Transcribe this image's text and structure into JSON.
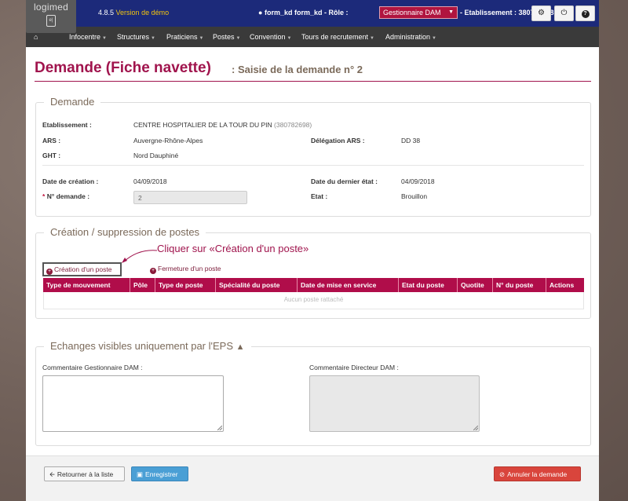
{
  "header": {
    "logo_text": "logimed",
    "logo_glyph": "e|",
    "version": "4.8.5",
    "version_tag": "Version de démo",
    "user": "form_kd form_kd - Rôle :",
    "role_value": "Gestionnaire DAM",
    "etablissement": "- Etablissement : 380782698",
    "icons": [
      "gear-icon",
      "power-icon",
      "help-icon"
    ]
  },
  "nav": {
    "home_icon": "home-icon",
    "items": [
      "Infocentre",
      "Structures",
      "Praticiens",
      "Postes",
      "Convention",
      "Tours de recrutement",
      "Administration"
    ]
  },
  "page": {
    "title": "Demande (Fiche navette)",
    "subtitle": ": Saisie de la demande n° 2"
  },
  "demande": {
    "legend": "Demande",
    "etab_label": "Etablissement :",
    "etab_value": "CENTRE HOSPITALIER DE LA TOUR DU PIN",
    "etab_code": "(380782698)",
    "ars_label": "ARS :",
    "ars_value": "Auvergne-Rhône-Alpes",
    "delegation_label": "Délégation ARS :",
    "delegation_value": "DD 38",
    "ght_label": "GHT :",
    "ght_value": "Nord Dauphiné",
    "creation_label": "Date de création :",
    "creation_value": "04/09/2018",
    "dernier_etat_label": "Date du dernier état :",
    "dernier_etat_value": "04/09/2018",
    "num_label": "N° demande :",
    "num_required": "*",
    "num_value": "2",
    "etat_label": "Etat :",
    "etat_value": "Brouillon"
  },
  "postes": {
    "legend": "Création / suppression de postes",
    "creation_btn": "Création d'un poste",
    "fermeture_btn": "Fermeture d'un poste",
    "annotation": "Cliquer sur «Création d'un poste»",
    "columns": [
      "Type de mouvement",
      "Pôle",
      "Type de poste",
      "Spécialité du poste",
      "Date de mise en service",
      "Etat du poste",
      "Quotite",
      "N° du poste",
      "Actions"
    ],
    "empty": "Aucun poste rattaché"
  },
  "echanges": {
    "legend": "Echanges visibles uniquement par l'EPS",
    "toggle_icon": "chevron-up-icon",
    "comment_gest_label": "Commentaire Gestionnaire DAM :",
    "comment_dir_label": "Commentaire Directeur DAM :"
  },
  "footer": {
    "back_btn": "Retourner à la liste",
    "save_btn": "Enregistrer",
    "cancel_btn": "Annuler la demande"
  }
}
